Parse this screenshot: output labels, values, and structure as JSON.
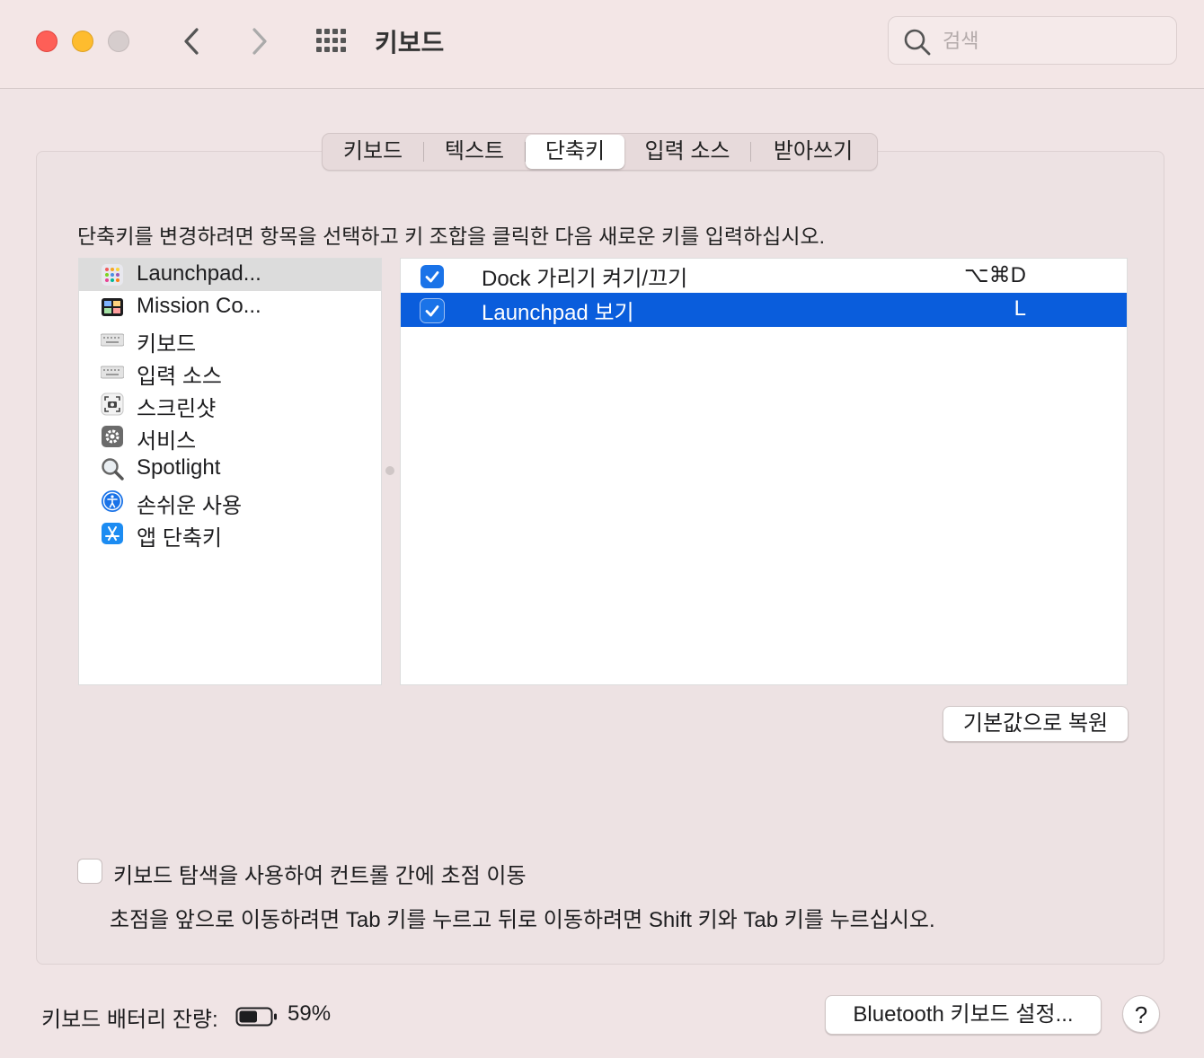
{
  "window": {
    "title": "키보드",
    "search_placeholder": "검색"
  },
  "tabs": [
    {
      "label": "키보드",
      "active": false
    },
    {
      "label": "텍스트",
      "active": false
    },
    {
      "label": "단축키",
      "active": true
    },
    {
      "label": "입력 소스",
      "active": false
    },
    {
      "label": "받아쓰기",
      "active": false
    }
  ],
  "instruction": "단축키를 변경하려면 항목을 선택하고 키 조합을 클릭한 다음 새로운 키를 입력하십시오.",
  "categories": [
    {
      "label": "Launchpad...",
      "icon": "launchpad-icon",
      "selected": true
    },
    {
      "label": "Mission Co...",
      "icon": "mission-control-icon",
      "selected": false
    },
    {
      "label": "키보드",
      "icon": "keyboard-icon",
      "selected": false
    },
    {
      "label": "입력 소스",
      "icon": "keyboard-icon",
      "selected": false
    },
    {
      "label": "스크린샷",
      "icon": "screenshot-icon",
      "selected": false
    },
    {
      "label": "서비스",
      "icon": "gear-icon",
      "selected": false
    },
    {
      "label": "Spotlight",
      "icon": "magnifier-icon",
      "selected": false
    },
    {
      "label": "손쉬운 사용",
      "icon": "accessibility-icon",
      "selected": false
    },
    {
      "label": "앱 단축키",
      "icon": "app-store-icon",
      "selected": false
    }
  ],
  "shortcuts": [
    {
      "name": "Dock 가리기 켜기/끄기",
      "keys": "⌥⌘D",
      "checked": true,
      "selected": false
    },
    {
      "name": "Launchpad 보기",
      "keys": "L",
      "checked": true,
      "selected": true
    }
  ],
  "restore_button": "기본값으로 복원",
  "full_keyboard": {
    "label": "키보드 탐색을 사용하여 컨트롤 간에 초점 이동",
    "checked": false,
    "note": "초점을 앞으로 이동하려면 Tab 키를 누르고 뒤로 이동하려면 Shift 키와 Tab 키를 누르십시오."
  },
  "battery": {
    "label": "키보드 배터리 잔량:",
    "percent_text": "59%",
    "level": 0.59
  },
  "bluetooth_button": "Bluetooth 키보드 설정...",
  "help_button": "?",
  "colors": {
    "selection": "#0a5ddc",
    "checkbox": "#1a73e8",
    "close": "#fe5f57",
    "minimize": "#febc2e"
  }
}
